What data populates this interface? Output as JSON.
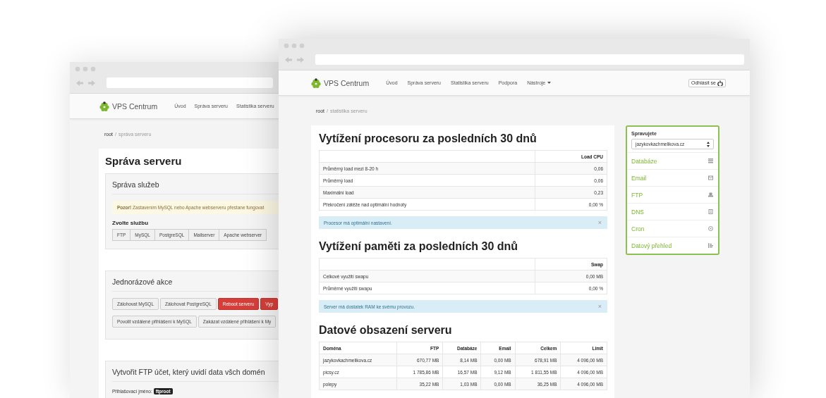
{
  "back_window": {
    "brand": "VPS Centrum",
    "nav": [
      "Úvod",
      "Správa serveru",
      "Statistika serveru"
    ],
    "breadcrumb": {
      "root": "root",
      "separator": "/",
      "current": "správa serveru"
    },
    "title": "Správa serveru",
    "panels": [
      {
        "title": "Správa služeb",
        "alert": "**Pozor!** Zastavením MySQL nebo Apache webserveru přestane fungovat",
        "label": "Zvolte službu",
        "button_group": [
          "FTP",
          "MySQL",
          "PostgreSQL",
          "Mailserver",
          "Apache webserver"
        ]
      },
      {
        "title": "Jednorázové akce",
        "button_rows": [
          [
            {
              "label": "Zálohovat MySQL",
              "kind": "default"
            },
            {
              "label": "Zálohovat PostgreSQL",
              "kind": "default"
            },
            {
              "label": "Reboot serveru",
              "kind": "danger"
            },
            {
              "label": "Vyp",
              "kind": "danger"
            }
          ],
          [
            {
              "label": "Povolit vzdálené přihlášení k MySQL",
              "kind": "default"
            },
            {
              "label": "Zakázat vzdálené přihlášení k My",
              "kind": "default"
            }
          ]
        ]
      },
      {
        "title": "Vytvořit FTP účet, který uvidí data všch domén",
        "login": {
          "label": "Přihlašovací jméno:",
          "value": "ftproot"
        }
      }
    ]
  },
  "front_window": {
    "brand": "VPS Centrum",
    "nav": [
      {
        "label": "Úvod",
        "dropdown": false
      },
      {
        "label": "Správa serveru",
        "dropdown": false
      },
      {
        "label": "Statistika serveru",
        "dropdown": false
      },
      {
        "label": "Podpora",
        "dropdown": false
      },
      {
        "label": "Nástroje",
        "dropdown": true
      }
    ],
    "logout": "Odhlásit se",
    "breadcrumb": {
      "root": "root",
      "separator": "/",
      "current": "statistika serveru"
    },
    "sections": [
      {
        "title": "Vytížení procesoru za posledních 30 dnů",
        "table": {
          "columns": [
            "",
            "Load CPU"
          ],
          "rows": [
            [
              "Průměrný load mezi 8-20 h",
              "0,06"
            ],
            [
              "Průměrný load",
              "0,06"
            ],
            [
              "Maximální load",
              "0,23"
            ],
            [
              "Překročení zátěže nad optimální hodnoty",
              "0,00 %"
            ]
          ]
        },
        "alert": {
          "text": "Procesor má optimální nastavení.",
          "close": "×"
        }
      },
      {
        "title": "Vytížení paměti za posledních 30 dnů",
        "table": {
          "columns": [
            "",
            "Swap"
          ],
          "rows": [
            [
              "Celkové využití swapu",
              "0,00 MB"
            ],
            [
              "Průměrné využití swapu",
              "0,00 %"
            ]
          ]
        },
        "alert": {
          "text": "Server má dostatek RAM ke svému provozu.",
          "close": "×"
        }
      },
      {
        "title": "Datové obsazení serveru",
        "table": {
          "columns": [
            "Doména",
            "FTP",
            "Databáze",
            "Email",
            "Celkem",
            "Limit"
          ],
          "rows": [
            [
              "jazykovkachmelikova.cz",
              "670,77 MB",
              "8,14 MB",
              "0,00 MB",
              "678,91 MB",
              "4 096,00 MB"
            ],
            [
              "picsy.cz",
              "1 785,86 MB",
              "16,57 MB",
              "9,12 MB",
              "1 811,55 MB",
              "4 096,00 MB"
            ],
            [
              "polepy",
              "35,22 MB",
              "1,03 MB",
              "0,00 MB",
              "36,25 MB",
              "4 096,00 MB"
            ]
          ]
        }
      }
    ],
    "sidebar": {
      "label": "Spravujete",
      "select": "jazykovkachmelikova.cz",
      "items": [
        "Databáze",
        "Email",
        "FTP",
        "DNS",
        "Cron",
        "Datový přehled"
      ]
    }
  }
}
